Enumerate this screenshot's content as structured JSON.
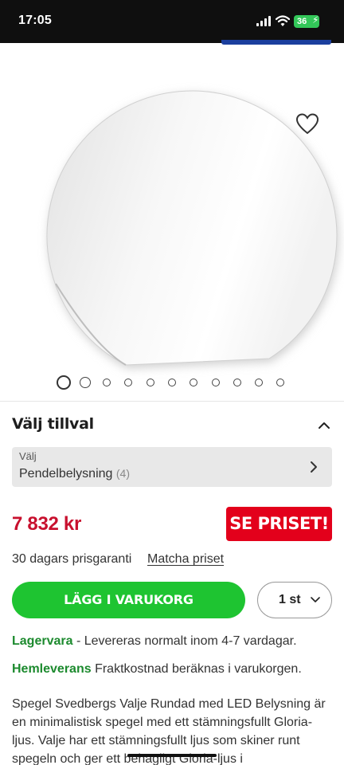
{
  "status_bar": {
    "time": "17:05",
    "battery": "36",
    "signal_icon": "cellular-signal-icon",
    "wifi_icon": "wifi-icon",
    "battery_icon": "battery-charging-icon"
  },
  "product_image": {
    "favorite_icon": "heart-outline-icon",
    "gallery_count": 11,
    "active_index": 0
  },
  "options": {
    "title": "Välj tillval",
    "collapse_icon": "chevron-up-icon",
    "select_label": "Välj",
    "select_value": "Pendelbelysning",
    "select_count": "(4)",
    "select_icon": "chevron-right-icon"
  },
  "price": {
    "value": "7 832 kr",
    "badge": "SE PRISET!",
    "guarantee": "30 dagars prisgaranti",
    "match_link": "Matcha priset"
  },
  "cart": {
    "add_label": "LÄGG I VARUKORG",
    "qty_value": "1 st",
    "qty_icon": "chevron-down-icon"
  },
  "stock": {
    "status": "Lagervara",
    "status_text": " - Levereras normalt inom 4-7 vardagar.",
    "delivery": "Hemleverans",
    "delivery_text": " Fraktkostnad beräknas i varukorgen."
  },
  "description": "Spegel Svedbergs Valje Rundad med LED Belysning är en minimalistisk spegel med ett stämningsfullt Gloria-ljus. Valje har ett stämningsfullt ljus som skiner runt spegeln och ger ett behagligt Gloria-ljus i",
  "colors": {
    "price_red": "#c8102e",
    "badge_red": "#e3001b",
    "cart_green": "#1ec431",
    "stock_green": "#1c8a2e",
    "battery_green": "#33c759"
  }
}
